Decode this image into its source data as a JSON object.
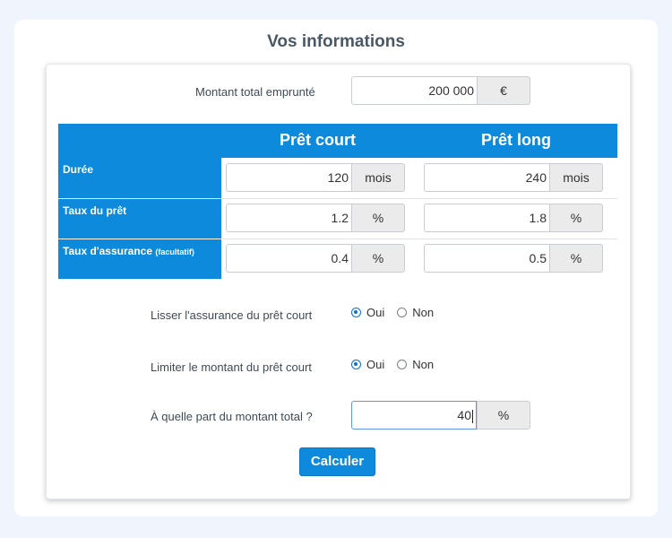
{
  "title": "Vos informations",
  "total": {
    "label": "Montant total emprunté",
    "value": "200 000",
    "unit": "€"
  },
  "table": {
    "columns": [
      "Prêt court",
      "Prêt long"
    ],
    "rows": [
      {
        "label": "Durée",
        "note": "",
        "court": "120",
        "long": "240",
        "unit": "mois"
      },
      {
        "label": "Taux du prêt",
        "note": "",
        "court": "1.2",
        "long": "1.8",
        "unit": "%"
      },
      {
        "label": "Taux d'assurance",
        "note": "(facultatif)",
        "court": "0.4",
        "long": "0.5",
        "unit": "%"
      }
    ]
  },
  "options": [
    {
      "label": "Lisser l'assurance du prêt court",
      "yes": "Oui",
      "no": "Non",
      "selected": "Oui"
    },
    {
      "label": "Limiter le montant du prêt court",
      "yes": "Oui",
      "no": "Non",
      "selected": "Oui"
    }
  ],
  "part": {
    "label": "À quelle part du montant total ?",
    "value": "40",
    "unit": "%"
  },
  "submit_label": "Calculer",
  "colors": {
    "accent": "#0d8adb",
    "radio": "#0d6fd1"
  }
}
